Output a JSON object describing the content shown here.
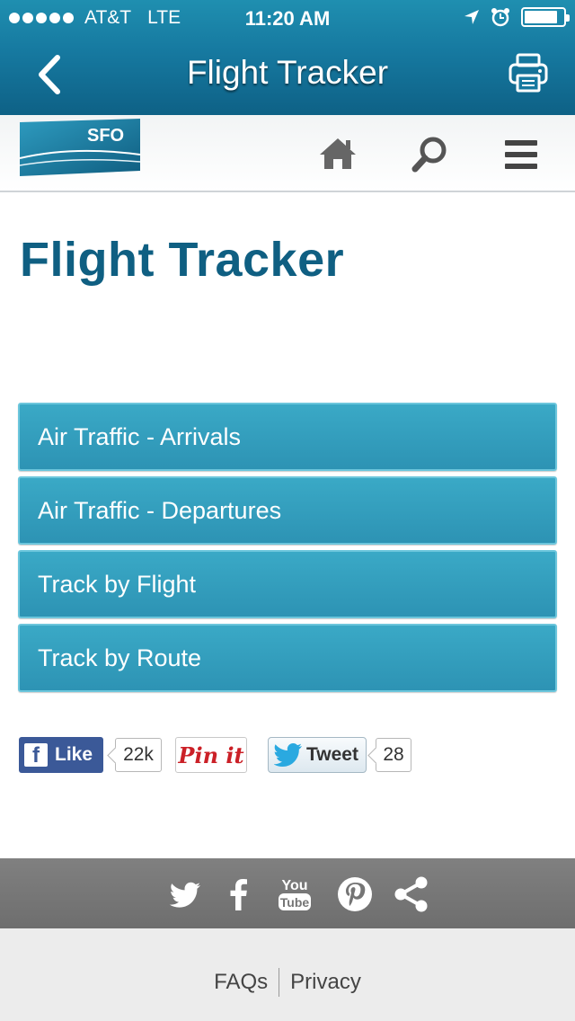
{
  "status_bar": {
    "carrier": "AT&T",
    "network": "LTE",
    "time": "11:20 AM",
    "battery_level": 0.85
  },
  "nav_bar": {
    "title": "Flight Tracker",
    "back_icon": "chevron-left-icon",
    "print_icon": "printer-icon"
  },
  "header": {
    "logo_text": "SFO",
    "icons": [
      "home-icon",
      "search-icon",
      "menu-icon"
    ]
  },
  "page": {
    "title": "Flight Tracker"
  },
  "links": [
    {
      "label": "Air Traffic - Arrivals"
    },
    {
      "label": "Air Traffic - Departures"
    },
    {
      "label": "Track by Flight"
    },
    {
      "label": "Track by Route"
    }
  ],
  "social_buttons": {
    "facebook_label": "Like",
    "facebook_count": "22k",
    "pinterest_label": "Pin it",
    "twitter_label": "Tweet",
    "twitter_count": "28"
  },
  "footer": {
    "social_icons": [
      "twitter-icon",
      "facebook-icon",
      "youtube-icon",
      "pinterest-icon",
      "share-icon"
    ],
    "youtube_text_top": "You",
    "youtube_text_bottom": "Tube",
    "links": [
      {
        "label": "FAQs"
      },
      {
        "label": "Privacy"
      }
    ]
  },
  "colors": {
    "nav_bar": "#1679a0",
    "title_blue": "#0f5f82",
    "button_teal": "#3199b8",
    "facebook_blue": "#3b5998",
    "pinterest_red": "#cb2027",
    "twitter_blue": "#2aa9e0"
  }
}
